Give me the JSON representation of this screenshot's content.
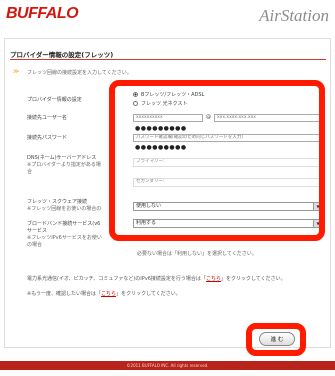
{
  "header": {
    "logo": "BUFFALO",
    "brand": "AirStation"
  },
  "page": {
    "section_title": "プロバイダー情報の設定(フレッツ)",
    "intro": "フレッツ回線の接続設定を入力してください。"
  },
  "provider_info": {
    "label": "プロバイダー情報の設定",
    "options": [
      "Bフレッツ/フレッツ・ADSL",
      "フレッツ 光ネクスト"
    ],
    "selected_index": 0
  },
  "username": {
    "label": "接続先ユーザー名",
    "value_left": "xxxxxxxxxx",
    "at": "@",
    "value_right": "xxx.xxxx.xxx.xxx"
  },
  "password": {
    "label": "接続先パスワード",
    "value": "●●●●●●●●●",
    "confirm_placeholder": "パスワード確認欄(確認のため同じパスワードを入力)",
    "confirm_value": "●●●●●●●●●"
  },
  "dns": {
    "label": "DNS(ネーム)サーバーアドレス",
    "note": "※プロバイダーより指定がある場",
    "note2": "合",
    "primary_placeholder": "プライマリー:",
    "secondary_placeholder": "セカンダリー:"
  },
  "flets_square": {
    "label": "フレッツ・スクウェア接続",
    "note": "※フレッツ回線をお使いの場合の",
    "value": "使用しない"
  },
  "broadband": {
    "label": "ブロードバンド接続サービス(v6",
    "label2": "サービス",
    "note": "※フレッツIPv6サービスをお使い",
    "note3": "の場合",
    "value": "利用する",
    "hint": "必要ない場合は「利用しない」を選択してください。"
  },
  "footer": {
    "line1_prefix": "電力系光通信(イオ、ピカッチ、コミュファなど)のIPv6接続設定を行う場合は「",
    "line1_link": "こちら",
    "line1_suffix": "」をクリックしてください。",
    "line2_prefix": "※もう一度、確認したい場合は「",
    "line2_link": "こちら",
    "line2_suffix": "」をクリックしてください。"
  },
  "buttons": {
    "next": "進 む"
  },
  "copyright": "©2011 BUFFALO INC. All rights reserved.",
  "colors": {
    "brand_red": "#d4160f",
    "highlight": "#ff1a00",
    "bar": "#b8241c"
  }
}
